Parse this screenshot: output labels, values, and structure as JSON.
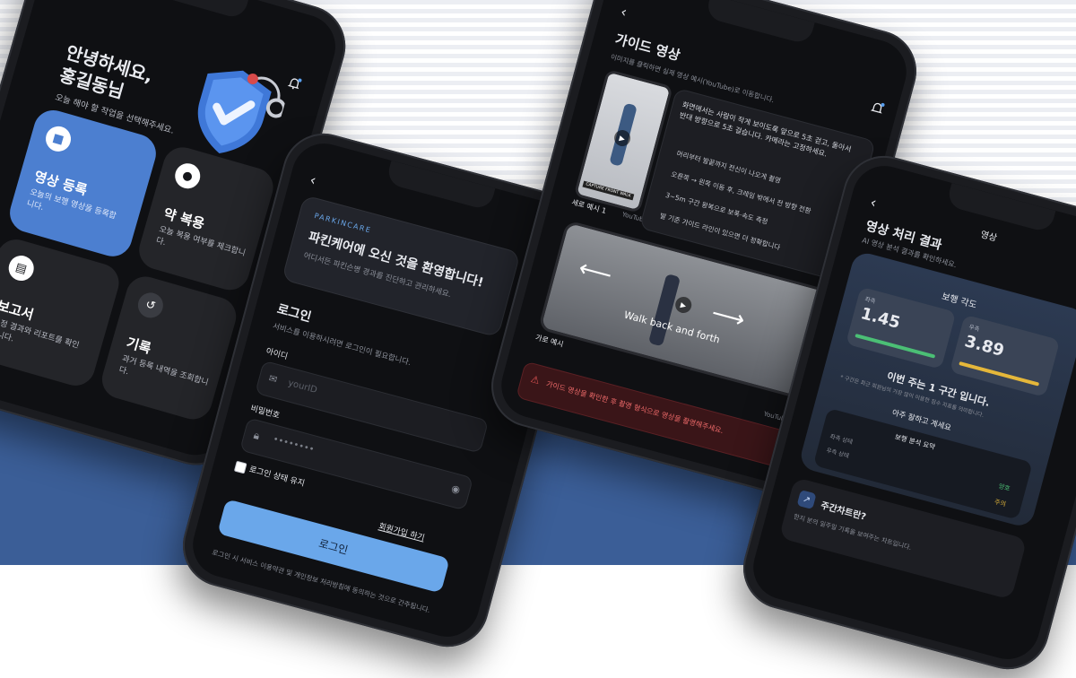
{
  "colors": {
    "accent": "#4a7fd0",
    "primary_button": "#6aa7ea",
    "good": "#4bbf75",
    "warn": "#e5b73a",
    "alert": "#e25555",
    "background_blue": "#3b5e97"
  },
  "phone1": {
    "greeting": "안녕하세요,",
    "user_name": "홍길동님",
    "subtitle": "오늘 해야 할 작업을 선택해주세요.",
    "tiles": [
      {
        "title": "영상 등록",
        "desc": "오늘의 보행 영상을 등록합니다.",
        "icon": "video-icon"
      },
      {
        "title": "약 복용",
        "desc": "오늘 복용 여부를 체크합니다.",
        "icon": "pill-icon"
      },
      {
        "title": "보고서",
        "desc": "측정 결과와 리포트를 확인합니다.",
        "icon": "report-icon"
      },
      {
        "title": "기록",
        "desc": "과거 등록 내역을 조회합니다.",
        "icon": "history-icon"
      }
    ]
  },
  "phone2": {
    "brand": "PARKINCARE",
    "welcome": "파킨케어에 오신 것을 환영합니다!",
    "welcome_sub": "어디서든 파킨슨병 경과를 진단하고 관리하세요.",
    "login_title": "로그인",
    "login_sub": "서비스를 이용하시려면 로그인이 필요합니다.",
    "id_label": "아이디",
    "id_placeholder": "yourID",
    "pw_label": "비밀번호",
    "pw_value": "••••••••",
    "remember_label": "로그인 상태 유지",
    "signup_link": "회원가입 하기",
    "login_button": "로그인",
    "terms": "로그인 시 서비스 이용약관 및 개인정보 처리방침에 동의하는 것으로 간주됩니다."
  },
  "phone3": {
    "title": "가이드 영상",
    "subtitle": "이미지를 클릭하면 실제 영상 예시(YouTube)로 이동합니다.",
    "portrait_caption": "세로 예시 1",
    "portrait_badge": "CAPTURE FRONT WALK",
    "landscape_caption": "가로 예시",
    "landscape_text": "Walk back and forth",
    "source": "YouTube",
    "instruction": "화면에서는 사람이 작게 보이도록 앞으로 5초 걷고, 돌아서 반대 방향으로 5초 걸습니다. 카메라는 고정하세요.",
    "bullets": [
      "머리부터 발끝까지 전신이 나오게 촬영",
      "오른쪽 → 왼쪽 이동 후, 크레임 밖에서 전 방향 전환",
      "3~5m 구간 왕복으로 보폭·속도 측정",
      "발 기준 가이드 라인이 있으면 더 정확합니다"
    ],
    "warning": "가이드 영상을 확인한 후 촬영 형식으로 영상을 촬영해주세요."
  },
  "phone4": {
    "header": "영상",
    "title": "영상 처리 결과",
    "subtitle": "AI 영상 분석 결과를 확인하세요.",
    "card_title": "보행 각도",
    "left_label": "좌측",
    "left_value": "1.45",
    "right_label": "우측",
    "right_value": "3.89",
    "unit": "°",
    "week_msg": "이번 주는 1 구간 입니다.",
    "week_sub": "* 구간은 최근 회원님의 가장 많이 이용한 점수 지표를 의미합니다.",
    "praise": "아주 잘하고 계세요",
    "summary_title": "보행 분석 요약",
    "summary_rows": [
      {
        "label": "좌측 상태",
        "value": "양호"
      },
      {
        "label": "우측 상태",
        "value": "주의"
      }
    ],
    "weekly_title": "주간차트란?",
    "weekly_text": "한지 분의 일주일 기록을 보여주는 차트입니다."
  }
}
